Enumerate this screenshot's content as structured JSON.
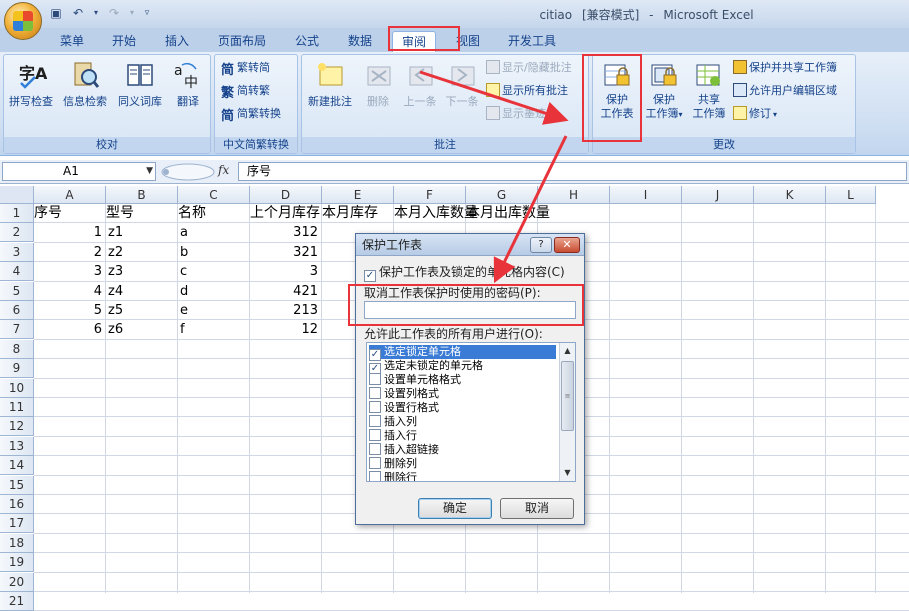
{
  "window": {
    "filename": "citiao",
    "mode": "[兼容模式]",
    "app": "Microsoft Excel"
  },
  "tabs": [
    "菜单",
    "开始",
    "插入",
    "页面布局",
    "公式",
    "数据",
    "审阅",
    "视图",
    "开发工具"
  ],
  "active_tab": "审阅",
  "ribbon": {
    "proofing": {
      "label": "校对",
      "buttons": [
        "拼写检查",
        "信息检索",
        "同义词库",
        "翻译"
      ]
    },
    "chinese_conversion": {
      "label": "中文简繁转换",
      "buttons": [
        "繁转简",
        "简转繁",
        "简繁转换"
      ]
    },
    "comments": {
      "label": "批注",
      "new_comment": "新建批注",
      "delete": "删除",
      "previous": "上一条",
      "next": "下一条",
      "show_hide": "显示/隐藏批注",
      "show_all": "显示所有批注",
      "show_ink": "显示墨迹"
    },
    "changes": {
      "label": "更改",
      "protect_sheet_1": "保护",
      "protect_sheet_2": "工作表",
      "protect_workbook_1": "保护",
      "protect_workbook_2": "工作簿",
      "share_workbook_1": "共享",
      "share_workbook_2": "工作簿",
      "protect_and_share": "保护并共享工作簿",
      "allow_edit_ranges": "允许用户编辑区域",
      "track_changes": "修订"
    }
  },
  "formula_bar": {
    "cell_ref": "A1",
    "fx": "fx",
    "content": "序号"
  },
  "grid": {
    "columns": [
      "A",
      "B",
      "C",
      "D",
      "E",
      "F",
      "G",
      "H",
      "I",
      "J",
      "K",
      "L"
    ],
    "rows": [
      "1",
      "2",
      "3",
      "4",
      "5",
      "6",
      "7",
      "8",
      "9",
      "10",
      "11",
      "12",
      "13",
      "14",
      "15",
      "16",
      "17",
      "18",
      "19",
      "20",
      "21"
    ],
    "header_row": [
      "序号",
      "型号",
      "名称",
      "上个月库存",
      "本月库存",
      "本月入库数量",
      "本月出库数量"
    ],
    "data": [
      [
        "1",
        "z1",
        "a",
        "312"
      ],
      [
        "2",
        "z2",
        "b",
        "321"
      ],
      [
        "3",
        "z3",
        "c",
        "3"
      ],
      [
        "4",
        "z4",
        "d",
        "421"
      ],
      [
        "5",
        "z5",
        "e",
        "213"
      ],
      [
        "6",
        "z6",
        "f",
        "12"
      ]
    ]
  },
  "dialog": {
    "title": "保护工作表",
    "help": "?",
    "close": "✕",
    "protect_checkbox": "保护工作表及锁定的单元格内容(C)",
    "password_label": "取消工作表保护时使用的密码(P):",
    "password_value": "",
    "allow_label": "允许此工作表的所有用户进行(O):",
    "options": [
      {
        "label": "选定锁定单元格",
        "checked": true,
        "selected": true
      },
      {
        "label": "选定未锁定的单元格",
        "checked": true,
        "selected": false
      },
      {
        "label": "设置单元格格式",
        "checked": false,
        "selected": false
      },
      {
        "label": "设置列格式",
        "checked": false,
        "selected": false
      },
      {
        "label": "设置行格式",
        "checked": false,
        "selected": false
      },
      {
        "label": "插入列",
        "checked": false,
        "selected": false
      },
      {
        "label": "插入行",
        "checked": false,
        "selected": false
      },
      {
        "label": "插入超链接",
        "checked": false,
        "selected": false
      },
      {
        "label": "删除列",
        "checked": false,
        "selected": false
      },
      {
        "label": "删除行",
        "checked": false,
        "selected": false
      }
    ],
    "ok": "确定",
    "cancel": "取消"
  },
  "colors": {
    "annotation_red": "#e8333a",
    "ribbon_text": "#15428b",
    "selection_blue": "#3a7bd5"
  }
}
